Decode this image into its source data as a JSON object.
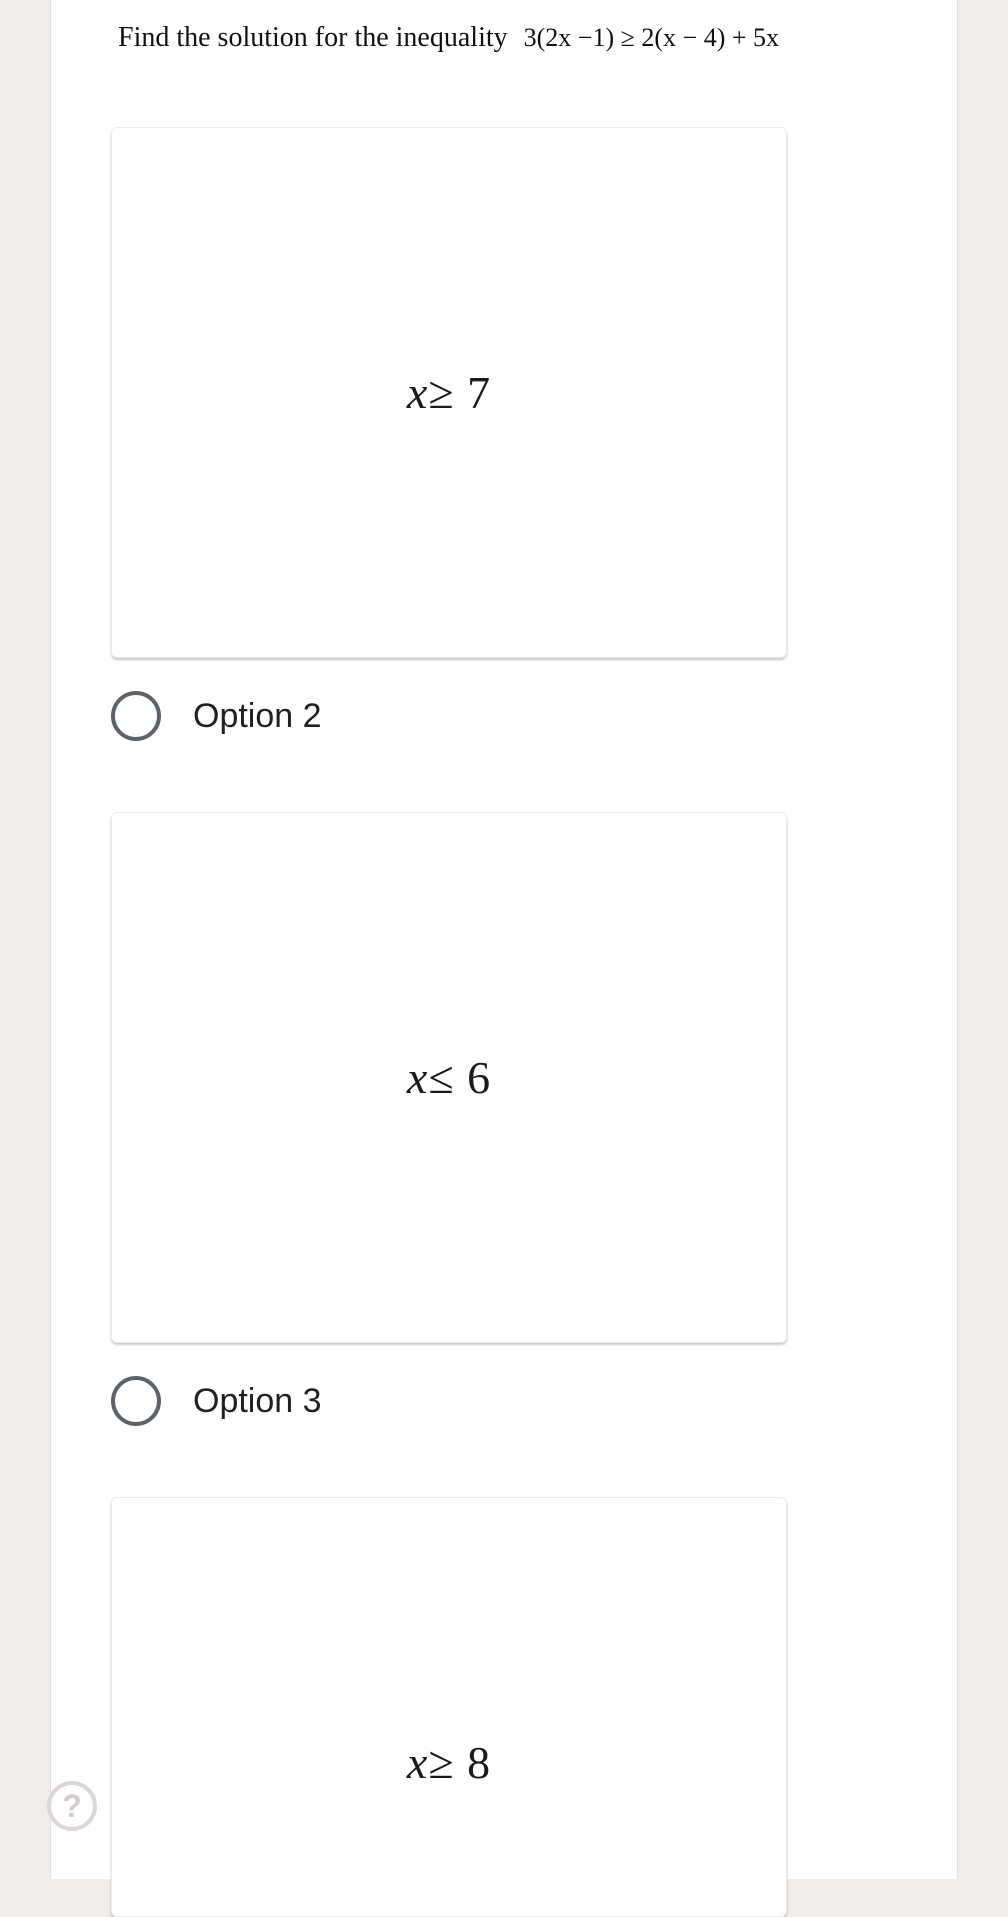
{
  "question": {
    "text": "Find the solution for the inequality",
    "formula": "3(2x −1) ≥ 2(x − 4) + 5x"
  },
  "options": [
    {
      "math_var": "x",
      "math_rel": "≥ 7"
    },
    {
      "label": "Option 2",
      "math_var": "x",
      "math_rel": "≤ 6"
    },
    {
      "label": "Option 3",
      "math_var": "x",
      "math_rel": "≥ 8"
    }
  ],
  "help": {
    "icon": "question-mark-icon",
    "glyph": "?"
  }
}
